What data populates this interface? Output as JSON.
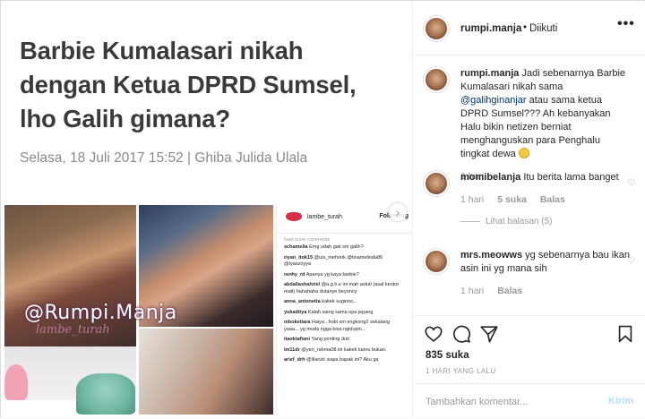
{
  "post_image": {
    "headline": "Barbie Kumalasari nikah dengan Ketua DPRD Sumsel, lho Galih gimana?",
    "dateline": "Selasa, 18 Juli 2017 15:52 | Ghiba Julida Ulala",
    "watermark": "@Rumpi.Manja",
    "watermark2": "lambe_turah",
    "mini_post": {
      "username": "lambe_turah",
      "follow_label": "Following",
      "load_more": "load more comments",
      "comments": [
        {
          "user": "schamelia",
          "text": "Emg udah gak sm galih?"
        },
        {
          "user": "riyan_itok15",
          "text": "@uis_mehonk @tinamelinda86 @tyaszoyya"
        },
        {
          "user": "renhy_rd",
          "text": "Apanya yg kaya barbie?"
        },
        {
          "user": "abdallashahriel",
          "text": "@a.g.h.e ini mah astuti (asal kentut mati) hahahaha dutanye beyoncy"
        },
        {
          "user": "anna_antonetta",
          "text": "kakek sugiono.."
        },
        {
          "user": "yukaditya",
          "text": "Kalah saing sama opa jepang"
        },
        {
          "user": "mboketiara",
          "text": "Haiya ..hobi sm engkong2 sekalang yaaa... yg muda ngga bisa ngidupin..."
        },
        {
          "user": "itaoktafiani",
          "text": "Yang penting duit"
        },
        {
          "user": "im11dr",
          "text": "@yeri_rahma08 ini kakek kamu bukan."
        },
        {
          "user": "arief_drh",
          "text": "@illarizk siapa bapak ini? Aku ga"
        }
      ]
    }
  },
  "header": {
    "username": "rumpi.manja",
    "separator": "•",
    "follow_status": "Diikuti",
    "more": "•••"
  },
  "caption": {
    "username": "rumpi.manja",
    "text_before": "Jadi sebenarnya Barbie Kumalasari nikah sama",
    "mention": "@galihginanjar",
    "text_after": "atau sama ketua DPRD Sumsel??? Ah kebanyakan Halu bikin netizen berniat menghanguskan para Penghalu tingkat dewa",
    "time": "1 hari"
  },
  "comments": [
    {
      "username": "momibelanja",
      "text": "Itu berita lama banget",
      "time": "1 hari",
      "likes": "5 suka",
      "reply": "Balas",
      "view_replies": "Lihat balasan (5)"
    },
    {
      "username": "mrs.meowws",
      "text": "yg sebenarnya bau ikan asin ini yg mana sih",
      "time": "1 hari",
      "reply": "Balas"
    }
  ],
  "actions": {
    "likes": "835 suka",
    "posted_ago": "1 HARI YANG LALU",
    "comment_placeholder": "Tambahkan komentar...",
    "post_button": "Kirim"
  }
}
